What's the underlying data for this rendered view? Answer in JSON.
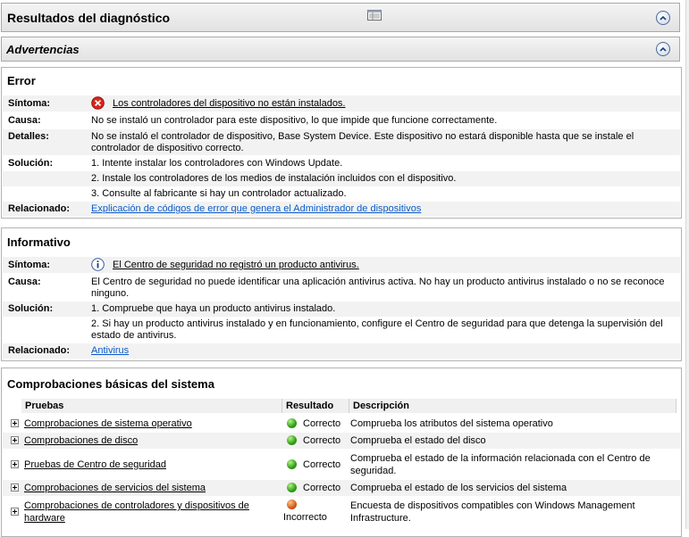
{
  "header": {
    "title": "Resultados del diagnóstico",
    "icon": "report-view-icon"
  },
  "warnings": {
    "title": "Advertencias"
  },
  "error": {
    "title": "Error",
    "symptom_label": "Síntoma:",
    "symptom": "Los controladores del dispositivo no están instalados.",
    "cause_label": "Causa:",
    "cause": "No se instaló un controlador para este dispositivo, lo que impide que funcione correctamente.",
    "details_label": "Detalles:",
    "details": "No se instaló el controlador de dispositivo, Base System Device. Este dispositivo no estará disponible hasta que se instale el controlador de dispositivo correcto.",
    "solution_label": "Solución:",
    "solutions": [
      "1. Intente instalar los controladores con Windows Update.",
      "2. Instale los controladores de los medios de instalación incluidos con el dispositivo.",
      "3. Consulte al fabricante si hay un controlador actualizado."
    ],
    "related_label": "Relacionado:",
    "related": "Explicación de códigos de error que genera el Administrador de dispositivos"
  },
  "info": {
    "title": "Informativo",
    "symptom_label": "Síntoma:",
    "symptom": "El Centro de seguridad no registró un producto antivirus.",
    "cause_label": "Causa:",
    "cause": "El Centro de seguridad no puede identificar una aplicación antivirus activa. No hay un producto antivirus instalado o no se reconoce ninguno.",
    "solution_label": "Solución:",
    "solutions": [
      "1. Compruebe que haya un producto antivirus instalado.",
      "2. Si hay un producto antivirus instalado y en funcionamiento, configure el Centro de seguridad para que detenga la supervisión del estado de antivirus."
    ],
    "related_label": "Relacionado:",
    "related": "Antivirus"
  },
  "checks": {
    "title": "Comprobaciones básicas del sistema",
    "columns": [
      "Pruebas",
      "Resultado",
      "Descripción"
    ],
    "rows": [
      {
        "test": "Comprobaciones de sistema operativo",
        "result": "Correcto",
        "status": "ok",
        "description": "Comprueba los atributos del sistema operativo"
      },
      {
        "test": "Comprobaciones de disco",
        "result": "Correcto",
        "status": "ok",
        "description": "Comprueba el estado del disco"
      },
      {
        "test": "Pruebas de Centro de seguridad",
        "result": "Correcto",
        "status": "ok",
        "description": "Comprueba el estado de la información relacionada con el Centro de seguridad."
      },
      {
        "test": "Comprobaciones de servicios del sistema",
        "result": "Correcto",
        "status": "ok",
        "description": "Comprueba el estado de los servicios del sistema"
      },
      {
        "test": "Comprobaciones de controladores y dispositivos de hardware",
        "result": "Incorrecto",
        "status": "fail",
        "description": "Encuesta de dispositivos compatibles con Windows Management Infrastructure."
      }
    ]
  },
  "colors": {
    "link": "#0a5bc8",
    "ok": "#2f9e14",
    "fail": "#d55a14",
    "error_icon": "#d9261c"
  }
}
